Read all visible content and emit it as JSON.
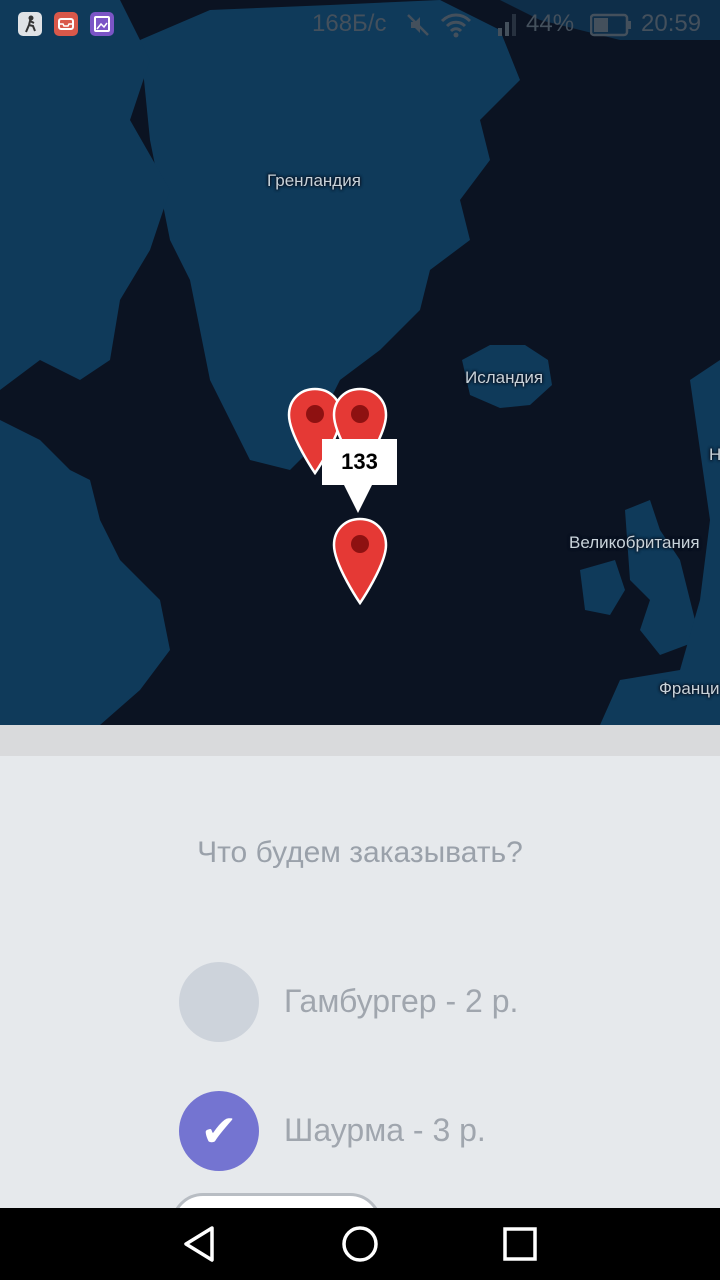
{
  "status_bar": {
    "network_speed": "168Б/с",
    "battery": "44%",
    "time": "20:59",
    "app_icons": [
      "runner-app-icon",
      "mail-app-icon",
      "gallery-app-icon"
    ]
  },
  "map": {
    "labels": {
      "greenland": "Гренландия",
      "iceland": "Исландия",
      "uk": "Великобритания",
      "france": "Франци",
      "edge": "Н"
    },
    "cluster_tooltip": "133",
    "colors": {
      "water": "#0b1322",
      "land": "#0f3a5a",
      "pin": "#e53935"
    }
  },
  "order": {
    "question": "Что будем заказывать?",
    "options": [
      {
        "label": "Гамбургер - 2 р.",
        "checked": false
      },
      {
        "label": "Шаурма - 3 р.",
        "checked": true
      }
    ],
    "accent": "#7474d1"
  },
  "nav": {
    "buttons": [
      "back-icon",
      "home-icon",
      "recents-icon"
    ]
  }
}
